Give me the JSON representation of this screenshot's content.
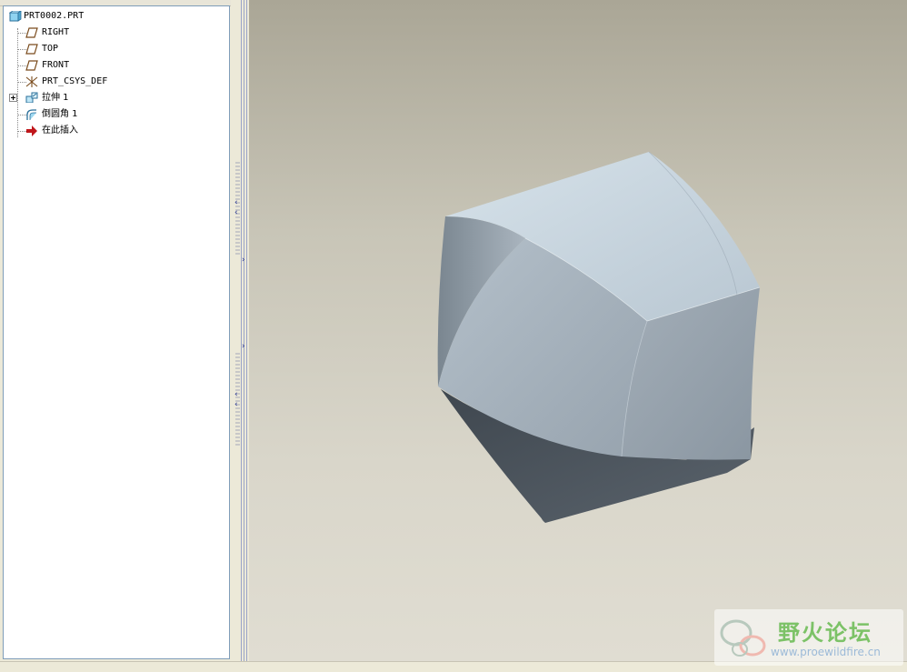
{
  "model_tree": {
    "root": "PRT0002.PRT",
    "items": [
      {
        "label": "RIGHT",
        "icon": "datum-plane-icon"
      },
      {
        "label": "TOP",
        "icon": "datum-plane-icon"
      },
      {
        "label": "FRONT",
        "icon": "datum-plane-icon"
      },
      {
        "label": "PRT_CSYS_DEF",
        "icon": "coordinate-system-icon"
      },
      {
        "label": "拉伸 1",
        "icon": "extrude-icon"
      },
      {
        "label": "倒圆角 1",
        "icon": "round-icon"
      },
      {
        "label": "在此插入",
        "icon": "insert-here-arrow-icon"
      }
    ]
  },
  "watermark": {
    "title": "野火论坛",
    "url": "www.proewildfire.cn"
  },
  "colors": {
    "tree_background": "#ffffff",
    "viewport_top": "#aaa696",
    "viewport_bottom": "#e0ddd2",
    "model_surface": "#a9b6c2",
    "model_shadow": "#4b545d",
    "watermark_green": "#7cc267",
    "insert_arrow": "#c0161b"
  }
}
